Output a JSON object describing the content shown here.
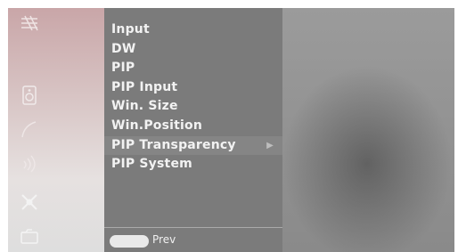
{
  "menu": {
    "items": [
      {
        "label": "Input"
      },
      {
        "label": "DW"
      },
      {
        "label": "PIP"
      },
      {
        "label": "PIP Input"
      },
      {
        "label": "Win. Size"
      },
      {
        "label": "Win.Position"
      },
      {
        "label": "PIP Transparency",
        "selected": true
      },
      {
        "label": "PIP System"
      }
    ],
    "submenu_arrow": "▶"
  },
  "footer": {
    "prev_label": "Prev",
    "prev_button_icon": "oval-button-icon"
  },
  "sidebar_icons": [
    "grid-icon",
    "blank-icon",
    "speaker-icon",
    "satellite-dish-icon",
    "signal-icon",
    "tools-icon",
    "folder-icon"
  ],
  "colors": {
    "menu_bg": "#7b7b7b",
    "selected_bg": "#858585",
    "text": "#f2f2f2"
  }
}
